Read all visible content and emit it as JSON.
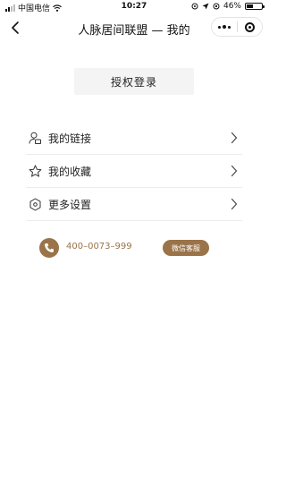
{
  "status_bar": {
    "carrier": "中国电信",
    "time": "10:27",
    "battery": "46%",
    "battery_level": 0.46,
    "icons": [
      "signal-icon",
      "wifi-icon",
      "location-icon",
      "alarm-icon",
      "battery-icon"
    ]
  },
  "nav": {
    "title": "人脉居间联盟 — 我的",
    "icons": [
      "back-icon",
      "more-icon",
      "close-icon"
    ]
  },
  "login": {
    "label": "授权登录"
  },
  "menu": {
    "items": [
      {
        "label": "我的链接",
        "icon": "user-link-icon"
      },
      {
        "label": "我的收藏",
        "icon": "star-icon"
      },
      {
        "label": "更多设置",
        "icon": "settings-hexagon-icon"
      }
    ]
  },
  "contact": {
    "phone": "400–0073–999",
    "wechat_label": "微信客服",
    "icon": "phone-icon"
  },
  "colors": {
    "accent": "#9a7349",
    "divider": "#ececec",
    "button_bg": "#f4f4f4"
  }
}
